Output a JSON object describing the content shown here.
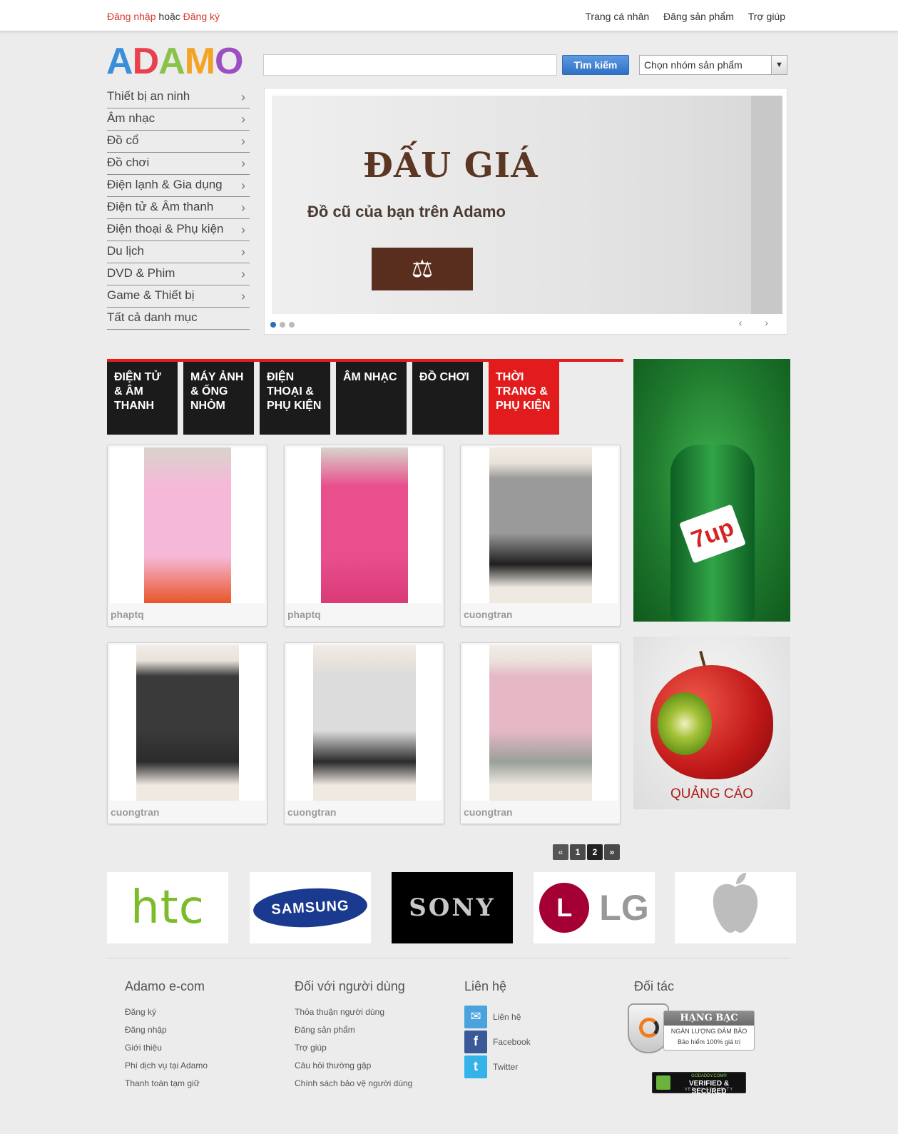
{
  "topbar": {
    "login": "Đăng nhập",
    "or": "hoặc",
    "register": "Đăng ký",
    "links": [
      "Trang cá nhân",
      "Đăng sản phẩm",
      "Trợ giúp"
    ]
  },
  "logo": {
    "letters": [
      {
        "ch": "A",
        "color": "#3a8fd9"
      },
      {
        "ch": "D",
        "color": "#e8414d"
      },
      {
        "ch": "A",
        "color": "#8bc34a"
      },
      {
        "ch": "M",
        "color": "#f4a322"
      },
      {
        "ch": "O",
        "color": "#9c4fc2"
      }
    ]
  },
  "search": {
    "value": "",
    "button": "Tìm kiếm",
    "category_select": "Chọn nhóm sản phẩm"
  },
  "sidemenu": [
    "Thiết bị an ninh",
    "Âm nhạc",
    "Đồ cổ",
    "Đồ chơi",
    "Điện lạnh & Gia dụng",
    "Điện tử & Âm thanh",
    "Điện thoại & Phụ kiện",
    "Du lịch",
    "DVD & Phim",
    "Game & Thiết bị",
    "Tất cả danh mục"
  ],
  "banner": {
    "title": "ĐẤU GIÁ",
    "subtitle": "Đồ cũ của bạn trên Adamo",
    "slides": 3,
    "active_slide": 1
  },
  "category_tabs": [
    "Điện tử & Âm thanh",
    "Máy ảnh & Ống nhòm",
    "Điện thoại & Phụ kiện",
    "Âm nhạc",
    "Đồ chơi",
    "Thời trang & Phụ kiện"
  ],
  "active_tab": 5,
  "products": [
    {
      "user": "phaptq",
      "photo": "kids-floral-outfit",
      "colors": [
        "#f6b8d8",
        "#e8562a"
      ]
    },
    {
      "user": "phaptq",
      "photo": "pink-tshirt",
      "colors": [
        "#e84f8c",
        "#d93a78"
      ]
    },
    {
      "user": "cuongtran",
      "photo": "man-grey-shirt-shorts",
      "colors": [
        "#9a9a9a",
        "#1f1f1f"
      ]
    },
    {
      "user": "cuongtran",
      "photo": "black-lace-dress",
      "colors": [
        "#3a3a3a",
        "#2b2b2b"
      ]
    },
    {
      "user": "cuongtran",
      "photo": "zebra-dress",
      "colors": [
        "#dcdcdc",
        "#2b2b2b"
      ]
    },
    {
      "user": "cuongtran",
      "photo": "pink-camo-dress",
      "colors": [
        "#e6b8c6",
        "#9aa09a"
      ]
    }
  ],
  "ads": {
    "ad2_label": "QUẢNG CÁO",
    "ad1_logo": "7up"
  },
  "pager": {
    "prev": "«",
    "pages": [
      "1",
      "2"
    ],
    "current": "2",
    "next": "»"
  },
  "brands": {
    "htc": "htc",
    "samsung": "SAMSUNG",
    "sony": "SONY",
    "lg_mark": "L",
    "lg": "LG"
  },
  "footer": {
    "col1": {
      "title": "Adamo e-com",
      "links": [
        "Đăng ký",
        "Đăng nhập",
        "Giới thiệu",
        "Phí dịch vụ tại Adamo",
        "Thanh toán tạm giữ"
      ]
    },
    "col2": {
      "title": "Đối với người dùng",
      "links": [
        "Thỏa thuận người dùng",
        "Đăng sản phẩm",
        "Trợ giúp",
        "Câu hỏi thường gặp",
        "Chính sách bảo vệ người dùng"
      ]
    },
    "col3": {
      "title": "Liên hệ",
      "links": [
        "Liên hệ",
        "Facebook",
        "Twitter"
      ]
    },
    "col4": {
      "title": "Đối tác",
      "badge1": {
        "title": "HẠNG BẠC",
        "line1": "NGÂN LƯỢNG ĐẢM BẢO",
        "line2": "Bảo hiểm 100% giá trị"
      },
      "badge2": {
        "top": "GODADDY.COM®",
        "main": "VERIFIED & SECURED",
        "bottom": "VERIFY SECURITY"
      }
    }
  }
}
